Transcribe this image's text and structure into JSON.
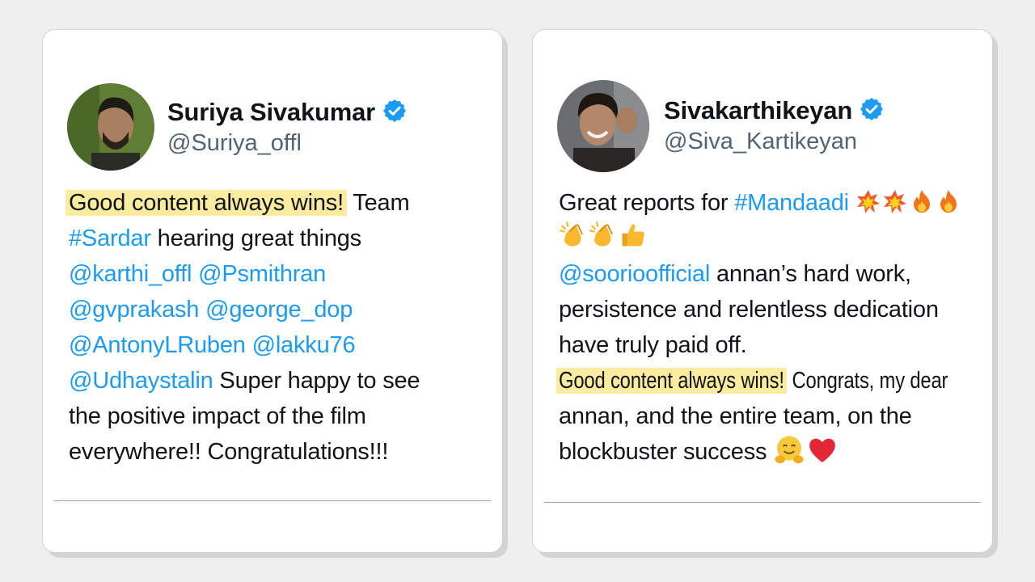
{
  "tweets": [
    {
      "name": "Suriya Sivakumar",
      "handle": "@Suriya_offl",
      "verified": true,
      "highlight": "Good content always wins!",
      "line1_rest": " Team",
      "line2_tag": "#Sardar",
      "line2_rest": " hearing great things",
      "line3_m1": "@karthi_offl",
      "line3_m2": "@Psmithran",
      "line4_m1": "@gvprakash",
      "line4_m2": "@george_dop",
      "line5_m1": "@AntonyLRuben",
      "line5_m2": "@lakku76",
      "line6_m1": "@Udhaystalin",
      "line6_rest": " Super happy to see",
      "line7": "the positive impact of the film",
      "line8": "everywhere!! Congratulations!!!"
    },
    {
      "name": "Sivakarthikeyan",
      "handle": "@Siva_Kartikeyan",
      "verified": true,
      "line1_text": "Great reports for ",
      "line1_tag": "#Mandaadi",
      "line1_emojis": [
        "collision-icon",
        "collision-icon",
        "fire-icon",
        "fire-icon"
      ],
      "line2_emojis": [
        "clapping-hands-icon",
        "clapping-hands-icon",
        "thumbs-up-icon"
      ],
      "line3_mention": "@soorioofficial",
      "line3_rest": " annan’s hard work,",
      "line4": "persistence and relentless dedication",
      "line5": "have truly paid off.",
      "highlight": "Good content always wins!",
      "line6_rest": " Congrats, my dear",
      "line7": "annan, and the entire team, on the",
      "line8": "blockbuster success",
      "line8_emojis": [
        "hugging-face-icon",
        "red-heart-icon"
      ]
    }
  ],
  "colors": {
    "mention": "#1d9bf0",
    "highlight": "#fbeca0",
    "text": "#0f1419",
    "handle": "#536471",
    "verified": "#1d9bf0"
  }
}
